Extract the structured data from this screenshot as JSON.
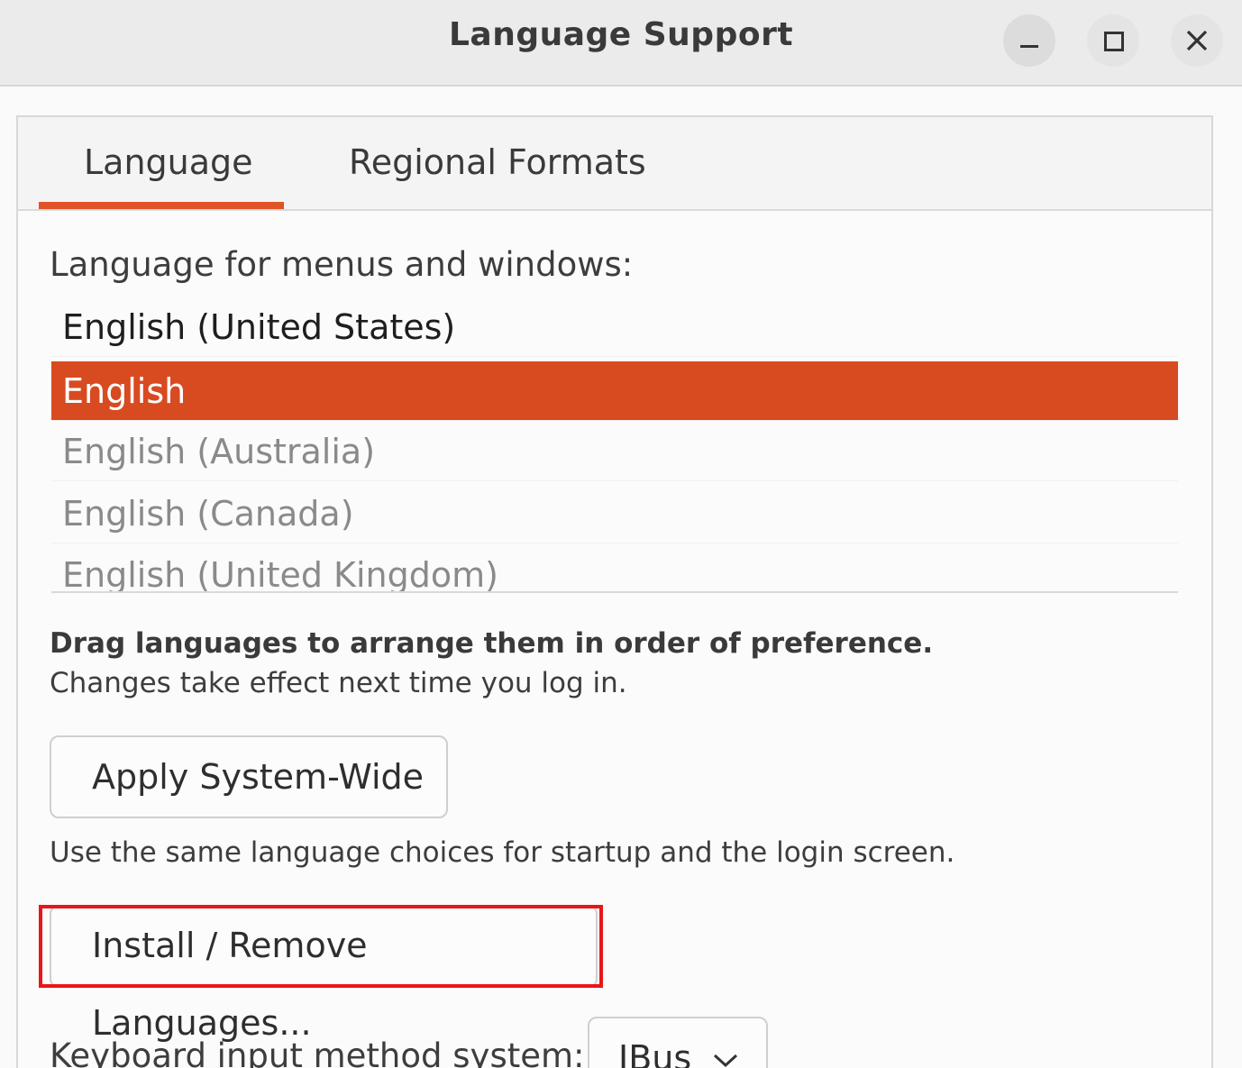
{
  "window": {
    "title": "Language Support"
  },
  "tabs": [
    {
      "label": "Language",
      "selected": true
    },
    {
      "label": "Regional Formats",
      "selected": false
    }
  ],
  "language_section": {
    "label": "Language for menus and windows:",
    "languages": [
      {
        "label": "English (United States)",
        "selected": false
      },
      {
        "label": "English",
        "selected": true
      },
      {
        "label": "English (Australia)",
        "selected": false
      },
      {
        "label": "English (Canada)",
        "selected": false
      },
      {
        "label": "English (United Kingdom)",
        "selected": false
      }
    ],
    "hint_bold": "Drag languages to arrange them in order of preference.",
    "hint": "Changes take effect next time you log in."
  },
  "actions": {
    "apply_label": "Apply System-Wide",
    "apply_description": "Use the same language choices for startup and the login screen.",
    "install_label": "Install / Remove Languages..."
  },
  "keyboard": {
    "label": "Keyboard input method system:",
    "selected_value": "IBus"
  },
  "colors": {
    "accent": "#d84a20",
    "highlight_box": "#e8161b"
  },
  "icons": {
    "minimize": "minimize-icon",
    "maximize": "maximize-icon",
    "close": "close-icon",
    "dropdown": "chevron-down-icon"
  }
}
